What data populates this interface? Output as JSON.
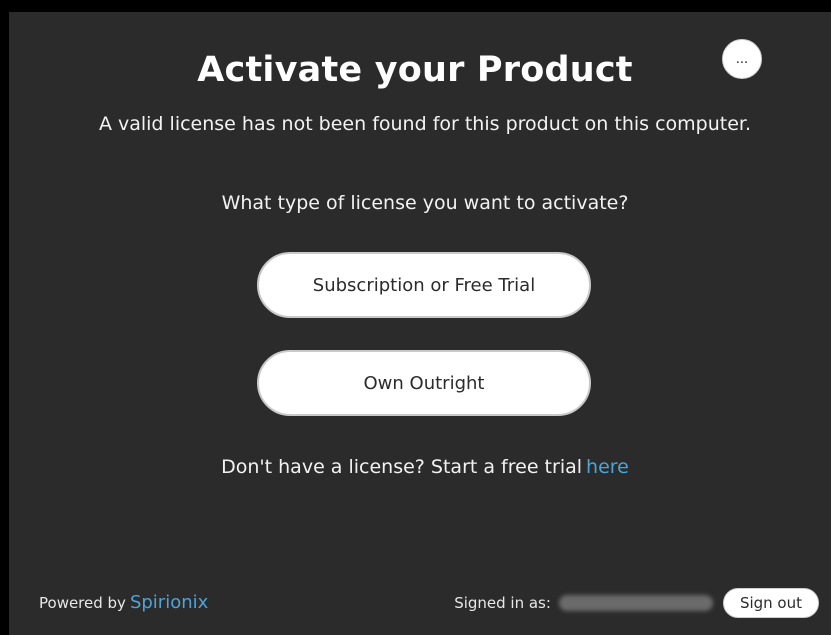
{
  "dialog": {
    "title": "Activate your Product",
    "more_button_label": "...",
    "subtitle": "A valid license has not been found for this product on this computer.",
    "question": "What type of license you want to activate?",
    "options": [
      {
        "label": "Subscription or Free Trial"
      },
      {
        "label": "Own Outright"
      }
    ],
    "trial_prompt": "Don't have a license? Start a free trial",
    "trial_link": "here"
  },
  "footer": {
    "powered_by": "Powered by",
    "brand": "Spirionix",
    "signed_in_label": "Signed in as:",
    "email": "",
    "sign_out_label": "Sign out"
  },
  "colors": {
    "background": "#2b2b2b",
    "accent": "#4ea3d8",
    "button_bg": "#ffffff"
  }
}
